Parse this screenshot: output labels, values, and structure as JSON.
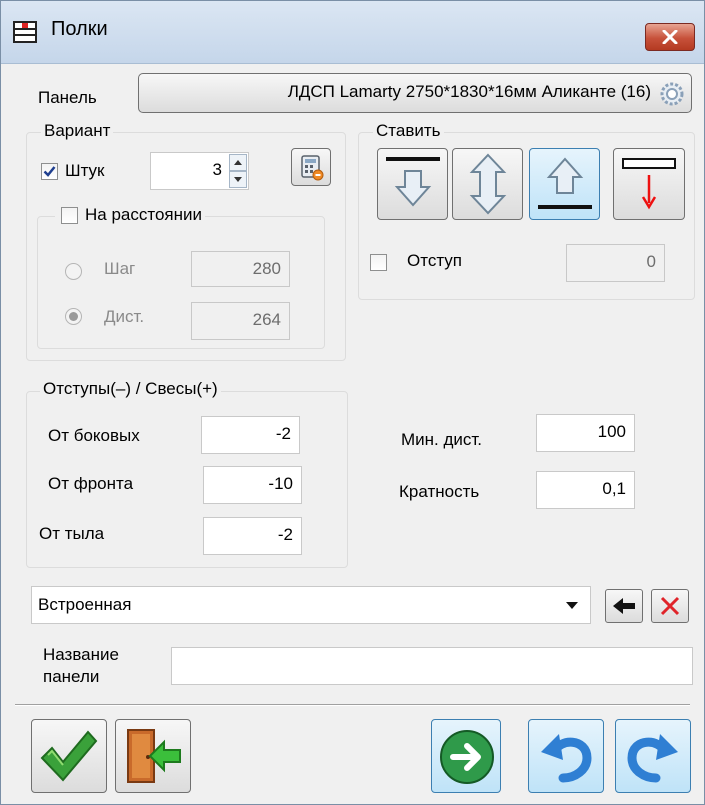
{
  "window": {
    "title": "Полки",
    "close_label": "x"
  },
  "panel": {
    "label": "Панель",
    "material": "ЛДСП Lamarty 2750*1830*16мм Аликанте (16)"
  },
  "variant": {
    "legend": "Вариант",
    "count_label": "Штук",
    "count_checked": true,
    "count_value": "3",
    "at_distance_label": "На расстоянии",
    "at_distance_checked": false,
    "step_label": "Шаг",
    "step_value": "280",
    "dist_label": "Дист.",
    "dist_value": "264",
    "dist_selected": true
  },
  "placement": {
    "legend": "Ставить",
    "buttons": [
      "align-top-down-icon",
      "center-updown-icon",
      "align-bottom-up-icon",
      "drop-down-icon"
    ],
    "active_index": 2,
    "offset_label": "Отступ",
    "offset_checked": false,
    "offset_value": "0"
  },
  "offsets": {
    "legend": "Отступы(–) / Свесы(+)",
    "side_label": "От боковых",
    "side_value": "-2",
    "front_label": "От фронта",
    "front_value": "-10",
    "back_label": "От тыла",
    "back_value": "-2"
  },
  "min_dist": {
    "label": "Мин. дист.",
    "value": "100"
  },
  "multiplicity": {
    "label": "Кратность",
    "value": "0,1"
  },
  "type_select": {
    "value": "Встроенная"
  },
  "panel_name": {
    "label_line1": "Название",
    "label_line2": "панели",
    "value": ""
  },
  "colors": {
    "accent_green": "#3aa13a",
    "accent_blue": "#2f7fd3",
    "close_red": "#c7513a"
  }
}
